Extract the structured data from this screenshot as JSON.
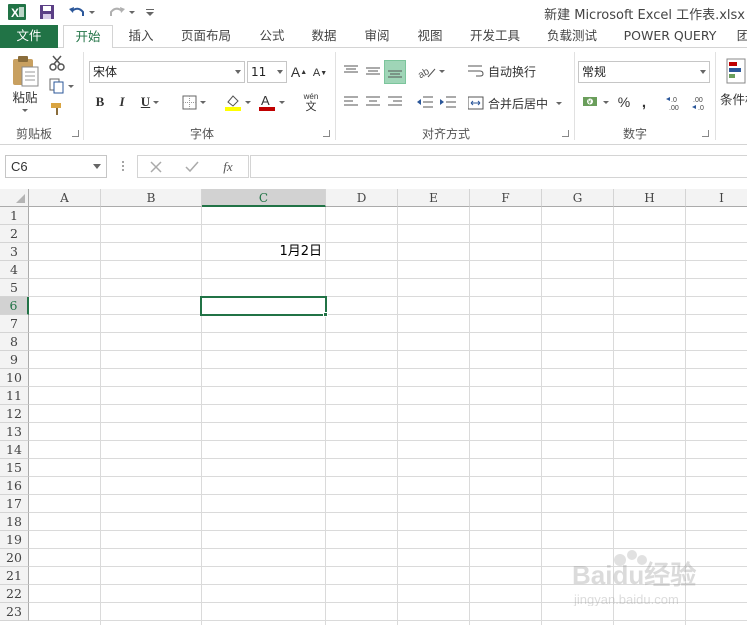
{
  "window": {
    "title": "新建 Microsoft Excel 工作表.xlsx"
  },
  "tabs": [
    {
      "label": "文件"
    },
    {
      "label": "开始"
    },
    {
      "label": "插入"
    },
    {
      "label": "页面布局"
    },
    {
      "label": "公式"
    },
    {
      "label": "数据"
    },
    {
      "label": "审阅"
    },
    {
      "label": "视图"
    },
    {
      "label": "开发工具"
    },
    {
      "label": "负载测试"
    },
    {
      "label": "POWER QUERY"
    },
    {
      "label": "团"
    }
  ],
  "ribbon": {
    "clipboard": {
      "paste_label": "粘贴",
      "group_label": "剪贴板"
    },
    "font": {
      "font_name": "宋体",
      "font_size": "11",
      "bold": "B",
      "italic": "I",
      "underline": "U",
      "grow": "A",
      "shrink": "A",
      "phonetic": "wén",
      "phonetic_char": "文",
      "group_label": "字体",
      "highlight_color": "#ffff00",
      "font_color": "#c00000"
    },
    "alignment": {
      "wrap_text": "自动换行",
      "merge_center": "合并后居中",
      "group_label": "对齐方式"
    },
    "number": {
      "format": "常规",
      "percent": "%",
      "comma": ",",
      "inc_decimal": ".0\n.00",
      "dec_decimal": ".00\n.0",
      "group_label": "数字"
    },
    "styles": {
      "conditional_label": "条件格"
    }
  },
  "formula_bar": {
    "name_box": "C6",
    "fx": "fx",
    "formula": ""
  },
  "sheet": {
    "columns": [
      "A",
      "B",
      "C",
      "D",
      "E",
      "F",
      "G",
      "H",
      "I"
    ],
    "selected_column": "C",
    "rows": [
      "1",
      "2",
      "3",
      "4",
      "5",
      "6",
      "7",
      "8",
      "9",
      "10",
      "11",
      "12",
      "13",
      "14",
      "15",
      "16",
      "17",
      "18",
      "19",
      "20",
      "21",
      "22",
      "23"
    ],
    "selected_row": "6",
    "cells": {
      "C3": "1月2日"
    },
    "active_cell": "C6"
  },
  "watermark": {
    "text": "Baidu经验",
    "url": "jingyan.baidu.com"
  },
  "colors": {
    "accent": "#217346"
  }
}
